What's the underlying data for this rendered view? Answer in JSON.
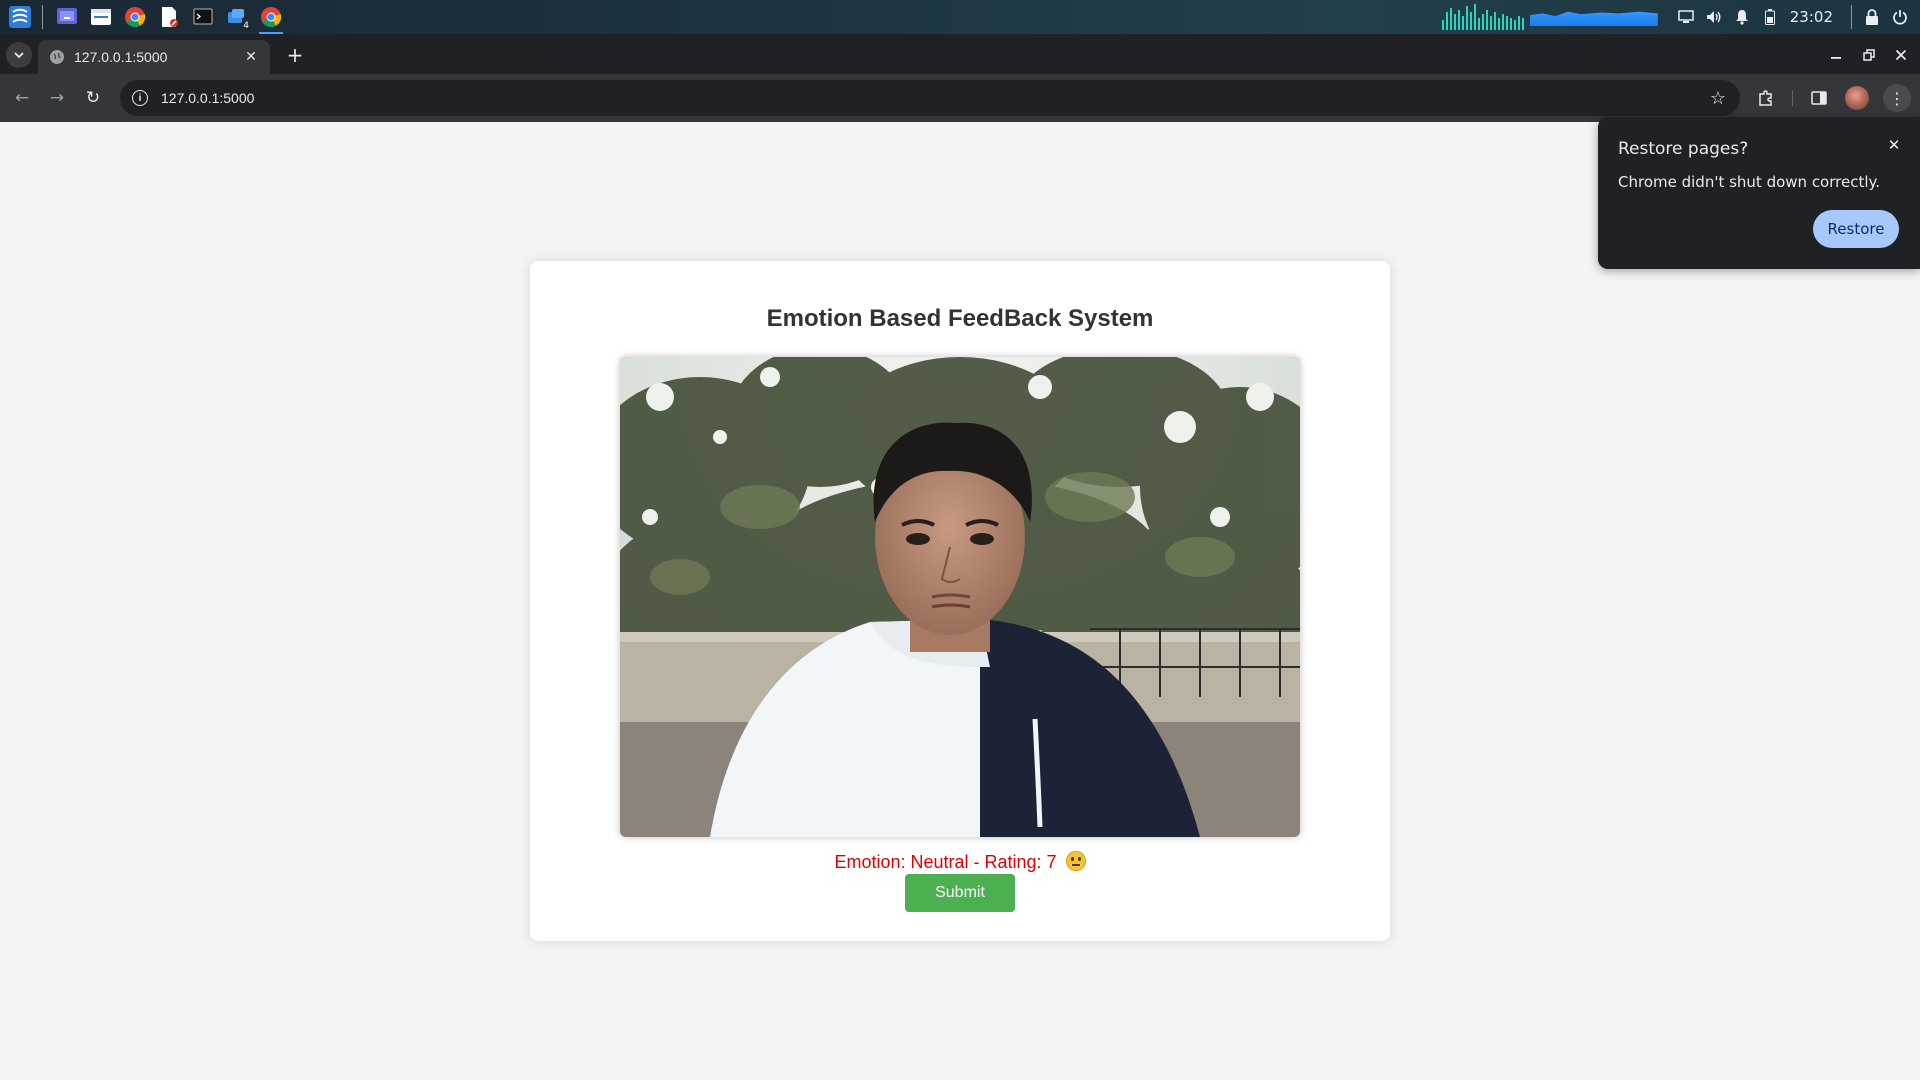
{
  "taskbar": {
    "apps": [
      {
        "icon": "app-launcher-icon"
      },
      {
        "icon": "desktop-icon"
      },
      {
        "icon": "file-manager-icon"
      },
      {
        "icon": "chrome-icon"
      },
      {
        "icon": "document-viewer-icon"
      },
      {
        "icon": "terminal-icon"
      },
      {
        "icon": "window-group-icon",
        "badge": "4"
      },
      {
        "icon": "chrome-icon"
      }
    ],
    "clock": "23:02",
    "tray_icons": [
      "screen-icon",
      "volume-icon",
      "bell-icon",
      "battery-icon",
      "lock-icon",
      "power-icon"
    ]
  },
  "browser": {
    "tab": {
      "title": "127.0.0.1:5000",
      "close": "✕"
    },
    "new_tab": "+",
    "window_controls": {
      "minimize": "–",
      "restore": "⧉",
      "close": "✕"
    },
    "nav": {
      "back": "←",
      "forward": "→",
      "reload": "↻"
    },
    "address": "127.0.0.1:5000",
    "star": "☆",
    "menu": "⋮"
  },
  "page": {
    "title": "Emotion Based FeedBack System",
    "emotion_text": "Emotion: Neutral - Rating: 7",
    "emoji": "neutral-face",
    "submit_label": "Submit"
  },
  "restore_popup": {
    "title": "Restore pages?",
    "body": "Chrome didn't shut down correctly.",
    "button": "Restore",
    "close": "✕"
  },
  "colors": {
    "accent_green": "#4caf50",
    "emotion_red": "#e00000",
    "popup_button": "#a8c7fa"
  }
}
